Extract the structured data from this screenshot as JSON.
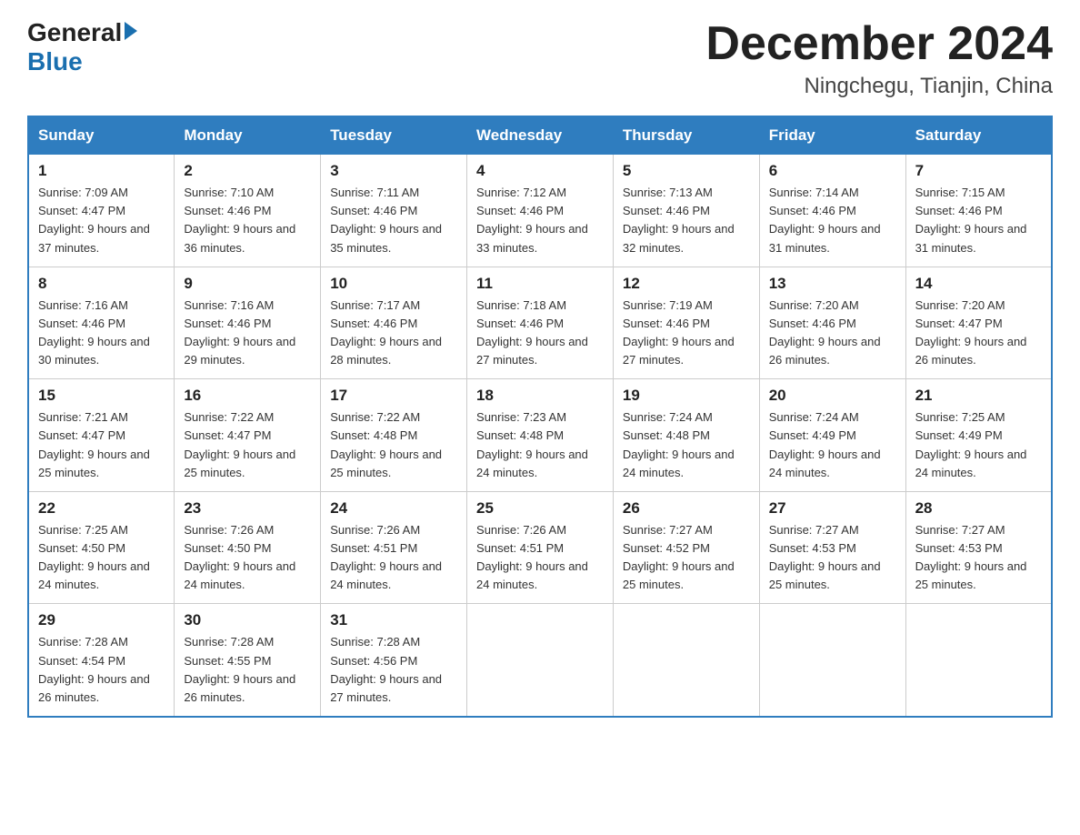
{
  "header": {
    "logo_text_general": "General",
    "logo_text_blue": "Blue",
    "month_title": "December 2024",
    "location": "Ningchegu, Tianjin, China"
  },
  "days_of_week": [
    "Sunday",
    "Monday",
    "Tuesday",
    "Wednesday",
    "Thursday",
    "Friday",
    "Saturday"
  ],
  "weeks": [
    [
      {
        "day": "1",
        "sunrise": "7:09 AM",
        "sunset": "4:47 PM",
        "daylight": "9 hours and 37 minutes."
      },
      {
        "day": "2",
        "sunrise": "7:10 AM",
        "sunset": "4:46 PM",
        "daylight": "9 hours and 36 minutes."
      },
      {
        "day": "3",
        "sunrise": "7:11 AM",
        "sunset": "4:46 PM",
        "daylight": "9 hours and 35 minutes."
      },
      {
        "day": "4",
        "sunrise": "7:12 AM",
        "sunset": "4:46 PM",
        "daylight": "9 hours and 33 minutes."
      },
      {
        "day": "5",
        "sunrise": "7:13 AM",
        "sunset": "4:46 PM",
        "daylight": "9 hours and 32 minutes."
      },
      {
        "day": "6",
        "sunrise": "7:14 AM",
        "sunset": "4:46 PM",
        "daylight": "9 hours and 31 minutes."
      },
      {
        "day": "7",
        "sunrise": "7:15 AM",
        "sunset": "4:46 PM",
        "daylight": "9 hours and 31 minutes."
      }
    ],
    [
      {
        "day": "8",
        "sunrise": "7:16 AM",
        "sunset": "4:46 PM",
        "daylight": "9 hours and 30 minutes."
      },
      {
        "day": "9",
        "sunrise": "7:16 AM",
        "sunset": "4:46 PM",
        "daylight": "9 hours and 29 minutes."
      },
      {
        "day": "10",
        "sunrise": "7:17 AM",
        "sunset": "4:46 PM",
        "daylight": "9 hours and 28 minutes."
      },
      {
        "day": "11",
        "sunrise": "7:18 AM",
        "sunset": "4:46 PM",
        "daylight": "9 hours and 27 minutes."
      },
      {
        "day": "12",
        "sunrise": "7:19 AM",
        "sunset": "4:46 PM",
        "daylight": "9 hours and 27 minutes."
      },
      {
        "day": "13",
        "sunrise": "7:20 AM",
        "sunset": "4:46 PM",
        "daylight": "9 hours and 26 minutes."
      },
      {
        "day": "14",
        "sunrise": "7:20 AM",
        "sunset": "4:47 PM",
        "daylight": "9 hours and 26 minutes."
      }
    ],
    [
      {
        "day": "15",
        "sunrise": "7:21 AM",
        "sunset": "4:47 PM",
        "daylight": "9 hours and 25 minutes."
      },
      {
        "day": "16",
        "sunrise": "7:22 AM",
        "sunset": "4:47 PM",
        "daylight": "9 hours and 25 minutes."
      },
      {
        "day": "17",
        "sunrise": "7:22 AM",
        "sunset": "4:48 PM",
        "daylight": "9 hours and 25 minutes."
      },
      {
        "day": "18",
        "sunrise": "7:23 AM",
        "sunset": "4:48 PM",
        "daylight": "9 hours and 24 minutes."
      },
      {
        "day": "19",
        "sunrise": "7:24 AM",
        "sunset": "4:48 PM",
        "daylight": "9 hours and 24 minutes."
      },
      {
        "day": "20",
        "sunrise": "7:24 AM",
        "sunset": "4:49 PM",
        "daylight": "9 hours and 24 minutes."
      },
      {
        "day": "21",
        "sunrise": "7:25 AM",
        "sunset": "4:49 PM",
        "daylight": "9 hours and 24 minutes."
      }
    ],
    [
      {
        "day": "22",
        "sunrise": "7:25 AM",
        "sunset": "4:50 PM",
        "daylight": "9 hours and 24 minutes."
      },
      {
        "day": "23",
        "sunrise": "7:26 AM",
        "sunset": "4:50 PM",
        "daylight": "9 hours and 24 minutes."
      },
      {
        "day": "24",
        "sunrise": "7:26 AM",
        "sunset": "4:51 PM",
        "daylight": "9 hours and 24 minutes."
      },
      {
        "day": "25",
        "sunrise": "7:26 AM",
        "sunset": "4:51 PM",
        "daylight": "9 hours and 24 minutes."
      },
      {
        "day": "26",
        "sunrise": "7:27 AM",
        "sunset": "4:52 PM",
        "daylight": "9 hours and 25 minutes."
      },
      {
        "day": "27",
        "sunrise": "7:27 AM",
        "sunset": "4:53 PM",
        "daylight": "9 hours and 25 minutes."
      },
      {
        "day": "28",
        "sunrise": "7:27 AM",
        "sunset": "4:53 PM",
        "daylight": "9 hours and 25 minutes."
      }
    ],
    [
      {
        "day": "29",
        "sunrise": "7:28 AM",
        "sunset": "4:54 PM",
        "daylight": "9 hours and 26 minutes."
      },
      {
        "day": "30",
        "sunrise": "7:28 AM",
        "sunset": "4:55 PM",
        "daylight": "9 hours and 26 minutes."
      },
      {
        "day": "31",
        "sunrise": "7:28 AM",
        "sunset": "4:56 PM",
        "daylight": "9 hours and 27 minutes."
      },
      null,
      null,
      null,
      null
    ]
  ]
}
